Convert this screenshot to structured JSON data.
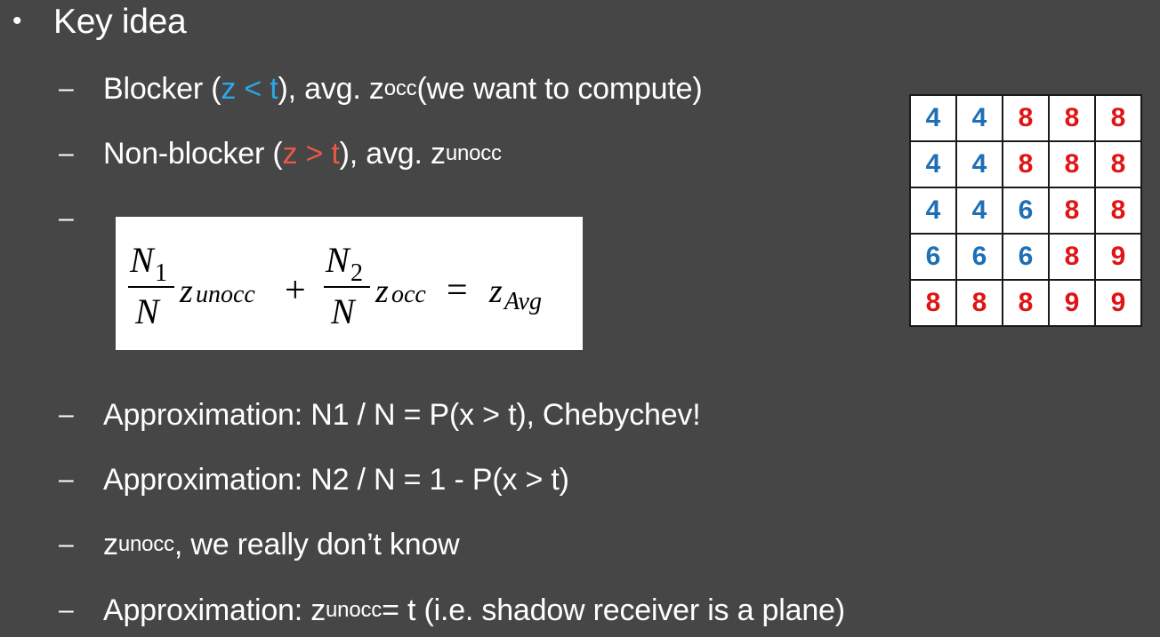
{
  "heading": {
    "bullet": "•",
    "text": "Key idea"
  },
  "items": {
    "blocker": {
      "dash": "–",
      "prefix": "Blocker (",
      "condition": "z < t",
      "mid": "), avg. z",
      "sub": "occ",
      "suffix": " (we want to compute)"
    },
    "nonblocker": {
      "dash": "–",
      "prefix": "Non-blocker (",
      "condition": "z > t",
      "mid": "), avg. z",
      "sub": "unocc"
    },
    "formula_dash": "–",
    "approx1": {
      "dash": "–",
      "text": "Approximation: N1 / N = P(x > t), Chebychev!"
    },
    "approx2": {
      "dash": "–",
      "text": "Approximation: N2 / N = 1 - P(x > t)"
    },
    "unknown": {
      "dash": "–",
      "pre": "z",
      "sub": "unocc",
      "text": ", we really don’t know"
    },
    "approx3": {
      "dash": "–",
      "pre": "Approximation: z",
      "sub": "unocc",
      "text": " = t (i.e. shadow receiver is a plane)"
    }
  },
  "formula": {
    "num1": "N",
    "num1_sub": "1",
    "den1": "N",
    "term1": "z",
    "term1_sub": "unocc",
    "plus": "+",
    "num2": "N",
    "num2_sub": "2",
    "den2": "N",
    "term2": "z",
    "term2_sub": "occ",
    "equals": "=",
    "rhs": "z",
    "rhs_sub": "Avg"
  },
  "grid": {
    "rows": [
      [
        {
          "v": "4",
          "c": "b"
        },
        {
          "v": "4",
          "c": "b"
        },
        {
          "v": "8",
          "c": "r"
        },
        {
          "v": "8",
          "c": "r"
        },
        {
          "v": "8",
          "c": "r"
        }
      ],
      [
        {
          "v": "4",
          "c": "b"
        },
        {
          "v": "4",
          "c": "b"
        },
        {
          "v": "8",
          "c": "r"
        },
        {
          "v": "8",
          "c": "r"
        },
        {
          "v": "8",
          "c": "r"
        }
      ],
      [
        {
          "v": "4",
          "c": "b"
        },
        {
          "v": "4",
          "c": "b"
        },
        {
          "v": "6",
          "c": "b"
        },
        {
          "v": "8",
          "c": "r"
        },
        {
          "v": "8",
          "c": "r"
        }
      ],
      [
        {
          "v": "6",
          "c": "b"
        },
        {
          "v": "6",
          "c": "b"
        },
        {
          "v": "6",
          "c": "b"
        },
        {
          "v": "8",
          "c": "r"
        },
        {
          "v": "9",
          "c": "r"
        }
      ],
      [
        {
          "v": "8",
          "c": "r"
        },
        {
          "v": "8",
          "c": "r"
        },
        {
          "v": "8",
          "c": "r"
        },
        {
          "v": "9",
          "c": "r"
        },
        {
          "v": "9",
          "c": "r"
        }
      ]
    ],
    "colors": {
      "b": "#1e6fb5",
      "r": "#e01414"
    }
  }
}
